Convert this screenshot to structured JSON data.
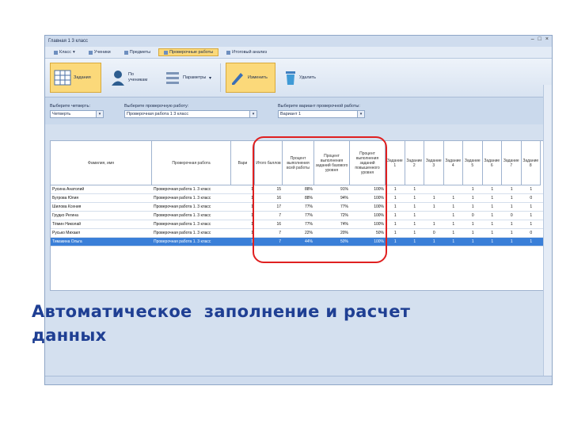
{
  "window": {
    "title": "Главная 1 3 класс"
  },
  "menu": [
    {
      "label": "Класс"
    },
    {
      "label": "Ученики"
    },
    {
      "label": "Предметы"
    },
    {
      "label": "Проверочные работы"
    },
    {
      "label": "Итоговый анализ"
    }
  ],
  "ribbon": {
    "task_label": "Задания",
    "students_label": "По ученикам",
    "settings_label": "Параметры",
    "edit_label": "Изменить",
    "delete_label": "Удалить"
  },
  "selectors": [
    {
      "caption": "Выберите четверть:",
      "value": "Четверть"
    },
    {
      "caption": "Выберите проверочную работу:",
      "value": "Проверочная работа 1 3 класс"
    },
    {
      "caption": "Выберите вариант проверочной работы:",
      "value": "Вариант 1"
    }
  ],
  "table": {
    "headers": {
      "name": "Фамилия, имя",
      "work": "Проверочная работа",
      "variant": "Вари",
      "total": "Итого баллов",
      "percent_done": "Процент выполнения всей работы",
      "percent_basic": "Процент выполнения заданий базового уровня",
      "percent_advanced": "Процент выполнения заданий повышенного уровня",
      "task_prefix": "Задание",
      "tasks": [
        "1",
        "2",
        "3",
        "4",
        "5",
        "6",
        "7",
        "8"
      ]
    },
    "rows": [
      {
        "name": "Русина Анатолий",
        "work": "Проверочная работа 1. 3 класс",
        "variant": "1",
        "total": "15",
        "p1": "88%",
        "p2": "91%",
        "p3": "100%",
        "t": [
          "1",
          "1",
          "",
          "",
          "1",
          "1",
          "1",
          "1"
        ]
      },
      {
        "name": "Бугрова Юлия",
        "work": "Проверочная работа 1. 3 класс",
        "variant": "1",
        "total": "16",
        "p1": "88%",
        "p2": "94%",
        "p3": "100%",
        "t": [
          "1",
          "1",
          "1",
          "1",
          "1",
          "1",
          "1",
          "0"
        ]
      },
      {
        "name": "Шилова Ксения",
        "work": "Проверочная работа 1. 3 класс",
        "variant": "1",
        "total": "17",
        "p1": "77%",
        "p2": "77%",
        "p3": "100%",
        "t": [
          "1",
          "1",
          "1",
          "1",
          "1",
          "1",
          "1",
          "1"
        ]
      },
      {
        "name": "Грудко Регина",
        "work": "Проверочная работа 1. 3 класс",
        "variant": "1",
        "total": "7",
        "p1": "77%",
        "p2": "72%",
        "p3": "100%",
        "t": [
          "1",
          "1",
          "",
          "1",
          "0",
          "1",
          "0",
          "1"
        ]
      },
      {
        "name": "Тёмин Николай",
        "work": "Проверочная работа 1. 3 класс",
        "variant": "1",
        "total": "16",
        "p1": "77%",
        "p2": "74%",
        "p3": "100%",
        "t": [
          "1",
          "1",
          "1",
          "1",
          "1",
          "1",
          "1",
          "1"
        ]
      },
      {
        "name": "Русько Михаил",
        "work": "Проверочная работа 1. 3 класс",
        "variant": "1",
        "total": "7",
        "p1": "22%",
        "p2": "20%",
        "p3": "50%",
        "t": [
          "1",
          "1",
          "0",
          "1",
          "1",
          "1",
          "1",
          "0"
        ]
      },
      {
        "name": "Тимакина Ольга",
        "work": "Проверочная работа 1. 3 класс",
        "variant": "1",
        "total": "7",
        "p1": "44%",
        "p2": "50%",
        "p3": "100%",
        "t": [
          "1",
          "1",
          "1",
          "1",
          "1",
          "1",
          "1",
          "1"
        ]
      }
    ]
  },
  "caption": {
    "line1": "Автоматическое  заполнение и расчет",
    "line2": "данных"
  },
  "colors": {
    "highlight_border": "#e02020",
    "caption_text": "#1f3f93",
    "selected_row": "#3a7fd8"
  }
}
